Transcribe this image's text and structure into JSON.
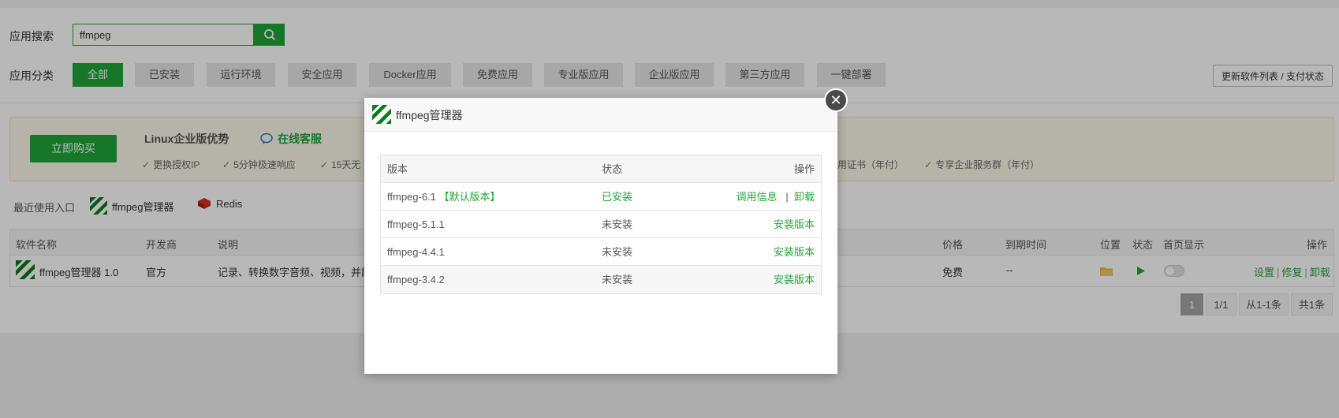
{
  "search": {
    "label": "应用搜索",
    "value": "ffmpeg"
  },
  "categories": {
    "label": "应用分类",
    "items": [
      "全部",
      "已安装",
      "运行环境",
      "安全应用",
      "Docker应用",
      "免费应用",
      "专业版应用",
      "企业版应用",
      "第三方应用",
      "一键部署"
    ],
    "active_index": 0
  },
  "update_button": "更新软件列表 / 支付状态",
  "promo": {
    "buy_button": "立即购买",
    "title": "Linux企业版优势",
    "online_service": "在线客服",
    "features": [
      "更换授权IP",
      "5分钟极速响应",
      "15天无",
      "用证书（年付）",
      "专享企业服务群（年付）"
    ]
  },
  "recent": {
    "label": "最近使用入口",
    "items": [
      {
        "name": "ffmpeg管理器",
        "icon": "ffmpeg-logo-icon"
      },
      {
        "name": "Redis",
        "icon": "redis-icon"
      }
    ]
  },
  "table": {
    "headers": {
      "name": "软件名称",
      "dev": "开发商",
      "desc": "说明",
      "price": "价格",
      "expire": "到期时间",
      "location": "位置",
      "status": "状态",
      "home": "首页显示",
      "ops": "操作"
    },
    "row": {
      "name": "ffmpeg管理器 1.0",
      "dev": "官方",
      "desc": "记录、转换数字音频、视频，并能将",
      "price": "免费",
      "expire": "--",
      "ops": [
        "设置",
        "修复",
        "卸载"
      ],
      "home_display_on": false
    }
  },
  "pagination": {
    "current": "1",
    "pages": "1/1",
    "range": "从1-1条",
    "total": "共1条"
  },
  "modal": {
    "title": "ffmpeg管理器",
    "columns": {
      "version": "版本",
      "status": "状态",
      "ops": "操作"
    },
    "rows": [
      {
        "version": "ffmpeg-6.1",
        "default_tag": "【默认版本】",
        "status": "已安装",
        "ops": [
          "调用信息",
          "卸载"
        ]
      },
      {
        "version": "ffmpeg-5.1.1",
        "status": "未安装",
        "ops": [
          "安装版本"
        ]
      },
      {
        "version": "ffmpeg-4.4.1",
        "status": "未安装",
        "ops": [
          "安装版本"
        ]
      },
      {
        "version": "ffmpeg-3.4.2",
        "status": "未安装",
        "ops": [
          "安装版本"
        ]
      }
    ]
  },
  "colors": {
    "accent": "#20a53a",
    "overlay": "rgba(0,0,0,0.28)"
  }
}
